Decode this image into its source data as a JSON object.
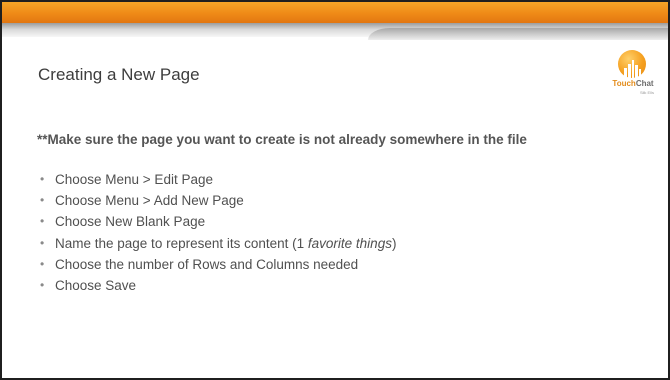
{
  "slide": {
    "title": "Creating a New Page",
    "intro": "**Make sure the page you want to create is not already somewhere in the file",
    "bullets": [
      "Choose Menu > Edit Page",
      "Choose Menu > Add New Page",
      "Choose New Blank Page",
      "Choose the number of Rows and Columns needed",
      "Choose Save"
    ],
    "name_bullet": {
      "before": "Name the page to represent its content (1 ",
      "emphasis": "favorite things",
      "after": ")"
    }
  },
  "logo": {
    "brand_first": "Touch",
    "brand_second": "Chat",
    "subtext": "Silk Ells"
  },
  "colors": {
    "accent_orange": "#ef8a17",
    "band_grey": "#d8d8d8",
    "text_grey": "#505050"
  },
  "icons": {
    "logo": "touchchat-logo-icon",
    "bullet": "bullet-dot"
  }
}
